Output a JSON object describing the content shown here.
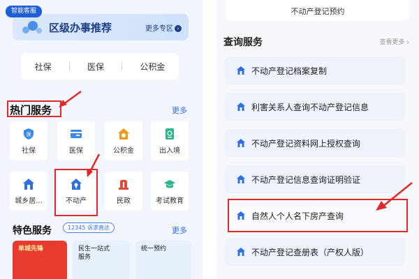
{
  "left": {
    "smart_badge": "智能客服",
    "recommend": {
      "title": "区级办事推荐",
      "more": "更多专区"
    },
    "quick_links": [
      "社保",
      "医保",
      "公积金"
    ],
    "hot": {
      "title": "热门服务",
      "more": "更多",
      "items": [
        {
          "label": "社保",
          "icon": "shield-icon",
          "color": "#3a8ae8"
        },
        {
          "label": "医保",
          "icon": "card-icon",
          "color": "#3a8ae8"
        },
        {
          "label": "公积金",
          "icon": "house-fund-icon",
          "color": "#f09a1c"
        },
        {
          "label": "出入境",
          "icon": "passport-icon",
          "color": "#2bb38a"
        },
        {
          "label": "城乡居...",
          "icon": "home-icon",
          "color": "#2f6fe0"
        },
        {
          "label": "不动产",
          "icon": "property-icon",
          "color": "#2f6fe0"
        },
        {
          "label": "民政",
          "icon": "civil-icon",
          "color": "#e04a3a"
        },
        {
          "label": "考试教育",
          "icon": "graduation-cap-icon",
          "color": "#2bb38a"
        }
      ]
    },
    "feature": {
      "title": "特色服务",
      "pill": "12345 诉求直达",
      "more": "更多",
      "cards": [
        {
          "text": "单城先锋",
          "color": "#e63b2e"
        },
        {
          "text": "民生一站式\n服务",
          "color": "#e6effc"
        },
        {
          "text": "统一预约",
          "color": "#e6effc"
        }
      ]
    }
  },
  "right": {
    "top_card": "不动产登记预约",
    "query": {
      "title": "查询服务",
      "more": "查看更多 ›",
      "items": [
        "不动产登记档案复制",
        "利害关系人查询不动产登记信息",
        "不动产登记资料网上授权查询",
        "不动产登记信息查询证明验证",
        "自然人个人名下房产查询",
        "不动产登记查册表（产权人版）"
      ]
    }
  },
  "colors": {
    "accent": "#2f6fe0",
    "highlight": "#e02828",
    "navy": "#1d3f86"
  }
}
